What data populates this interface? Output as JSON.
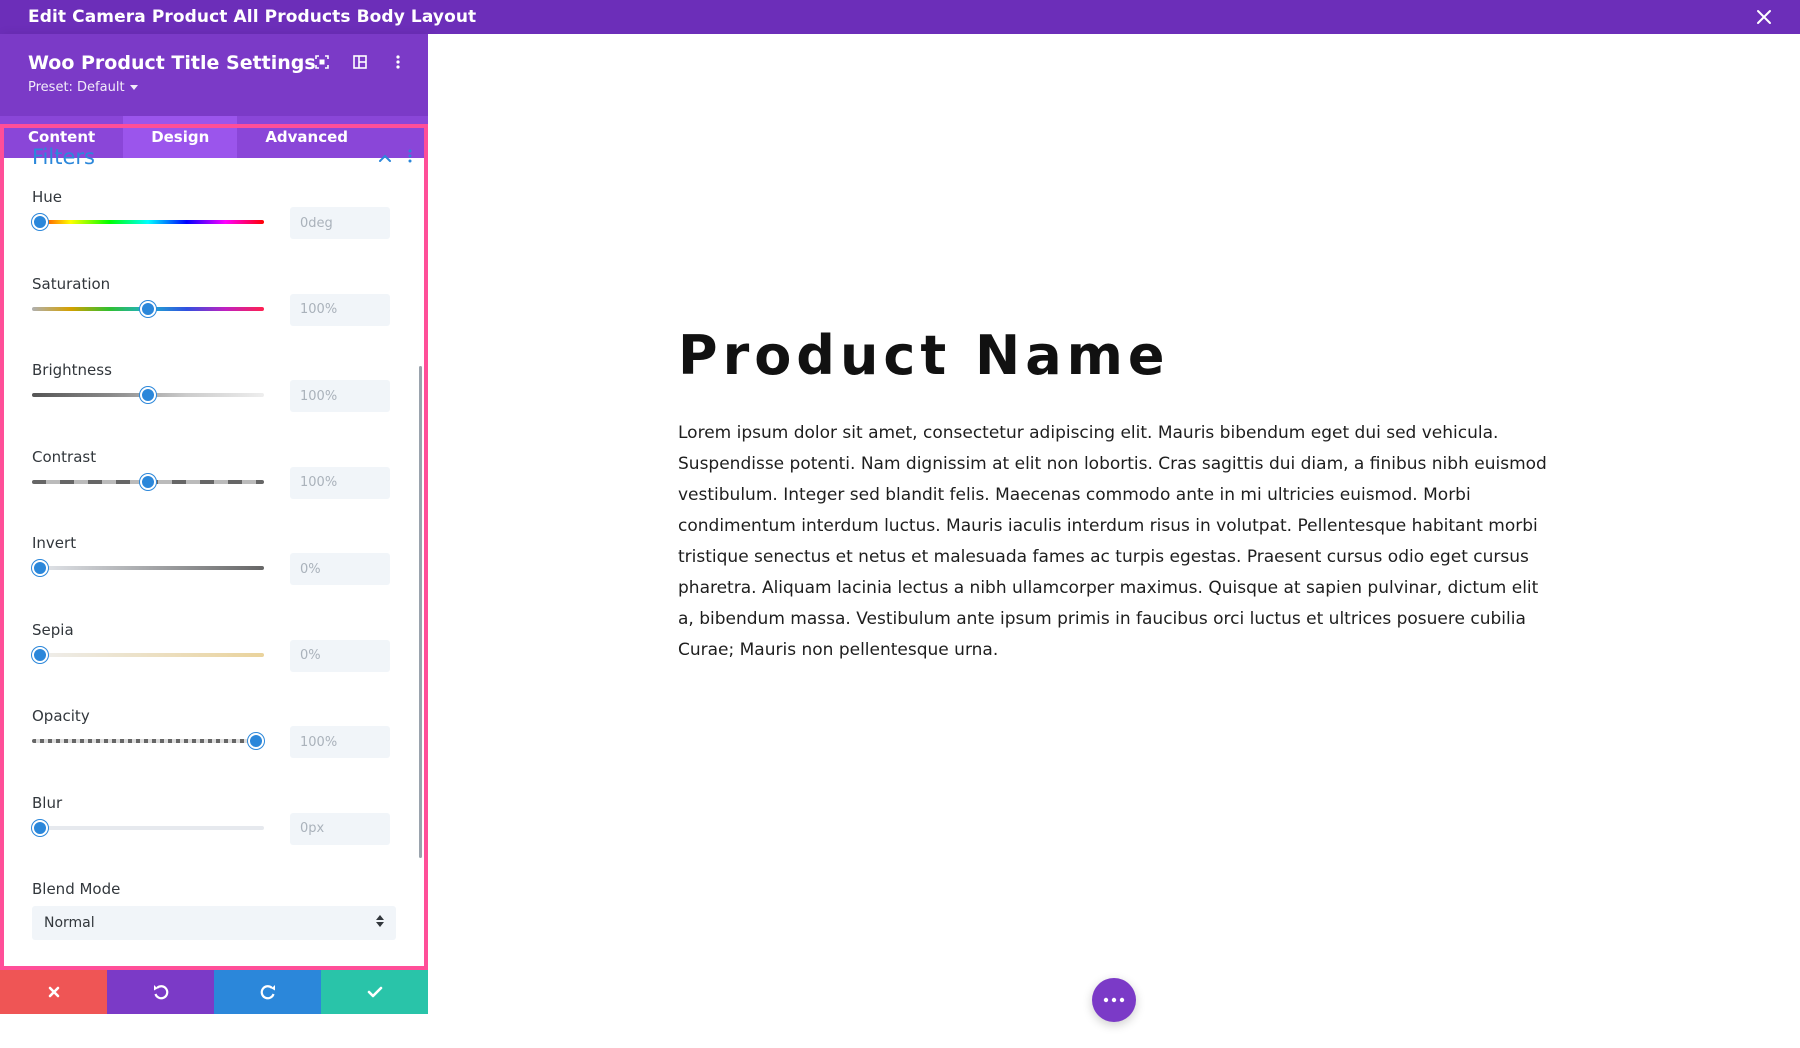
{
  "window": {
    "title": "Edit Camera Product All Products Body Layout"
  },
  "panel": {
    "title": "Woo Product Title Settings",
    "preset": "Preset: Default",
    "tabs": [
      {
        "label": "Content",
        "active": false
      },
      {
        "label": "Design",
        "active": true
      },
      {
        "label": "Advanced",
        "active": false
      }
    ],
    "section_title": "Filters",
    "filters": [
      {
        "label": "Hue",
        "value": "0deg",
        "position": 0.0
      },
      {
        "label": "Saturation",
        "value": "100%",
        "position": 0.5
      },
      {
        "label": "Brightness",
        "value": "100%",
        "position": 0.5
      },
      {
        "label": "Contrast",
        "value": "100%",
        "position": 0.5
      },
      {
        "label": "Invert",
        "value": "0%",
        "position": 0.0
      },
      {
        "label": "Sepia",
        "value": "0%",
        "position": 0.0
      },
      {
        "label": "Opacity",
        "value": "100%",
        "position": 1.0
      },
      {
        "label": "Blur",
        "value": "0px",
        "position": 0.0
      }
    ],
    "blend_mode": {
      "label": "Blend Mode",
      "selected": "Normal"
    },
    "bottom_buttons": [
      {
        "name": "discard",
        "color": "#ef5555"
      },
      {
        "name": "undo",
        "color": "#7b3ac7"
      },
      {
        "name": "redo",
        "color": "#2b87da"
      },
      {
        "name": "save",
        "color": "#29c4a9"
      }
    ]
  },
  "canvas": {
    "product_name": "Product Name",
    "description": "Lorem ipsum dolor sit amet, consectetur adipiscing elit. Mauris bibendum eget dui sed vehicula. Suspendisse potenti. Nam dignissim at elit non lobortis. Cras sagittis dui diam, a finibus nibh euismod vestibulum. Integer sed blandit felis. Maecenas commodo ante in mi ultricies euismod. Morbi condimentum interdum luctus. Mauris iaculis interdum risus in volutpat. Pellentesque habitant morbi tristique senectus et netus et malesuada fames ac turpis egestas. Praesent cursus odio eget cursus pharetra. Aliquam lacinia lectus a nibh ullamcorper maximus. Quisque at sapien pulvinar, dictum elit a, bibendum massa. Vestibulum ante ipsum primis in faucibus orci luctus et ultrices posuere cubilia Curae; Mauris non pellentesque urna."
  },
  "colors": {
    "topbar": "#6c2eb9",
    "panel_header": "#7b3ac7",
    "tab_active": "#9b55ec",
    "accent_blue": "#2b87da",
    "focus_border": "#ff4e98"
  }
}
